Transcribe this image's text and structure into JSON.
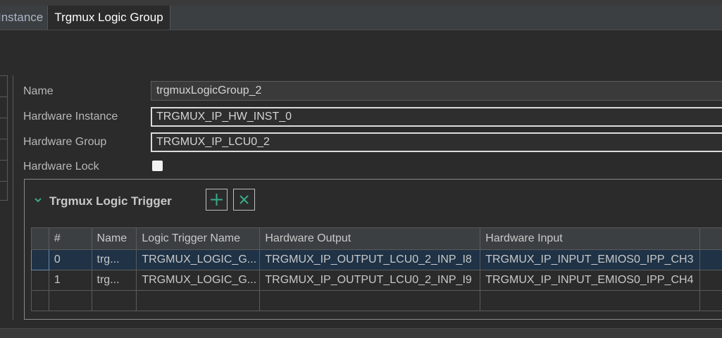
{
  "tabs": [
    {
      "label": "Instance"
    },
    {
      "label": "Trgmux Logic Group"
    }
  ],
  "form": {
    "name_label": "Name",
    "name_value": "trgmuxLogicGroup_2",
    "hw_instance_label": "Hardware Instance",
    "hw_instance_value": "TRGMUX_IP_HW_INST_0",
    "hw_group_label": "Hardware Group",
    "hw_group_value": "TRGMUX_IP_LCU0_2",
    "hw_lock_label": "Hardware Lock",
    "hw_lock_checked": false
  },
  "trigger_group": {
    "title": "Trgmux Logic Trigger",
    "expanded": true,
    "add_icon": "plus-icon",
    "remove_icon": "x-icon",
    "accent": "#3aa88a"
  },
  "table": {
    "columns": [
      "",
      "#",
      "Name",
      "Logic Trigger Name",
      "Hardware Output",
      "Hardware Input"
    ],
    "rows": [
      {
        "index": "0",
        "name": "trg...",
        "logic": "TRGMUX_LOGIC_G...",
        "output": "TRGMUX_IP_OUTPUT_LCU0_2_INP_I8",
        "input": "TRGMUX_IP_INPUT_EMIOS0_IPP_CH3",
        "selected": true
      },
      {
        "index": "1",
        "name": "trg...",
        "logic": "TRGMUX_LOGIC_G...",
        "output": "TRGMUX_IP_OUTPUT_LCU0_2_INP_I9",
        "input": "TRGMUX_IP_INPUT_EMIOS0_IPP_CH4",
        "selected": false
      }
    ]
  }
}
